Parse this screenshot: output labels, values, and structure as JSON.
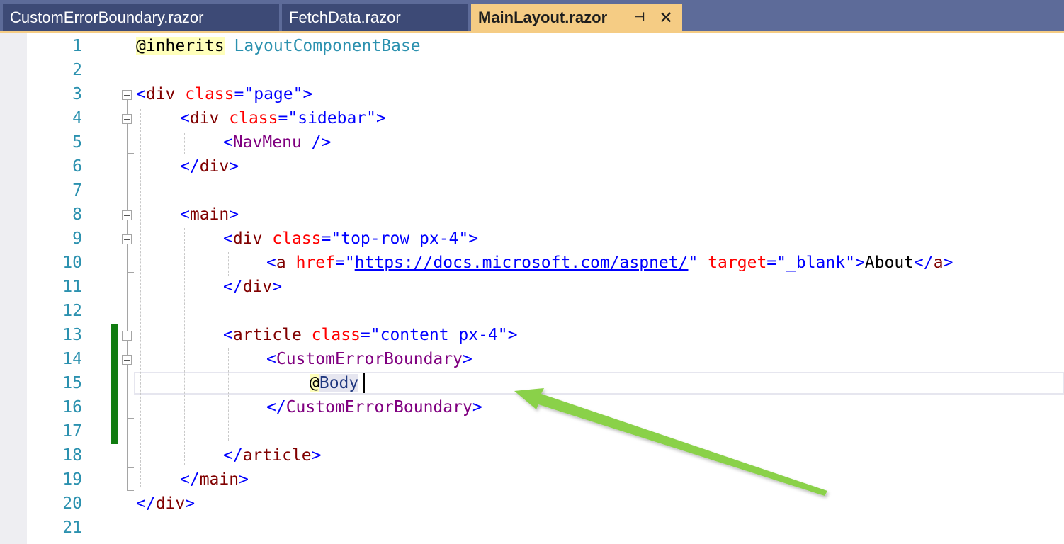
{
  "tabs": [
    {
      "label": "CustomErrorBoundary.razor"
    },
    {
      "label": "FetchData.razor"
    },
    {
      "label": "MainLayout.razor",
      "pin_icon": "pin-icon",
      "close_icon": "close-icon"
    }
  ],
  "editor": {
    "line_numbers": [
      "1",
      "2",
      "3",
      "4",
      "5",
      "6",
      "7",
      "8",
      "9",
      "10",
      "11",
      "12",
      "13",
      "14",
      "15",
      "16",
      "17",
      "18",
      "19",
      "20",
      "21"
    ],
    "code": {
      "l1": {
        "at": "@inherits",
        "type": "LayoutComponentBase"
      },
      "l3": {
        "open": "<",
        "tag": "div",
        "attr": "class",
        "eq": "=",
        "val": "\"page\"",
        "close": ">"
      },
      "l4": {
        "open": "<",
        "tag": "div",
        "attr": "class",
        "eq": "=",
        "val": "\"sidebar\"",
        "close": ">"
      },
      "l5": {
        "open": "<",
        "tag": "NavMenu",
        "close": " />"
      },
      "l6": {
        "open": "</",
        "tag": "div",
        "close": ">"
      },
      "l8": {
        "open": "<",
        "tag": "main",
        "close": ">"
      },
      "l9": {
        "open": "<",
        "tag": "div",
        "attr": "class",
        "eq": "=",
        "val": "\"top-row px-4\"",
        "close": ">"
      },
      "l10": {
        "open": "<",
        "tag": "a",
        "attr1": "href",
        "eq1": "=\"",
        "url": "https://docs.microsoft.com/aspnet/",
        "q1": "\"",
        "attr2": "target",
        "eq2": "=",
        "val2": "\"_blank\"",
        "close1": ">",
        "text": "About",
        "open2": "</",
        "tag2": "a",
        "close2": ">"
      },
      "l11": {
        "open": "</",
        "tag": "div",
        "close": ">"
      },
      "l13": {
        "open": "<",
        "tag": "article",
        "attr": "class",
        "eq": "=",
        "val": "\"content px-4\"",
        "close": ">"
      },
      "l14": {
        "open": "<",
        "tag": "CustomErrorBoundary",
        "close": ">"
      },
      "l15": {
        "at": "@",
        "body": "Body"
      },
      "l16": {
        "open": "</",
        "tag": "CustomErrorBoundary",
        "close": ">"
      },
      "l18": {
        "open": "</",
        "tag": "article",
        "close": ">"
      },
      "l19": {
        "open": "</",
        "tag": "main",
        "close": ">"
      },
      "l20": {
        "open": "</",
        "tag": "div",
        "close": ">"
      }
    }
  },
  "colors": {
    "tab_bar": "#5d6b99",
    "tab_inactive": "#3d4a76",
    "tab_active": "#f5cc84",
    "line_number": "#2b91af",
    "change_bar": "#107c10",
    "annotation_arrow": "#8ad14a"
  }
}
